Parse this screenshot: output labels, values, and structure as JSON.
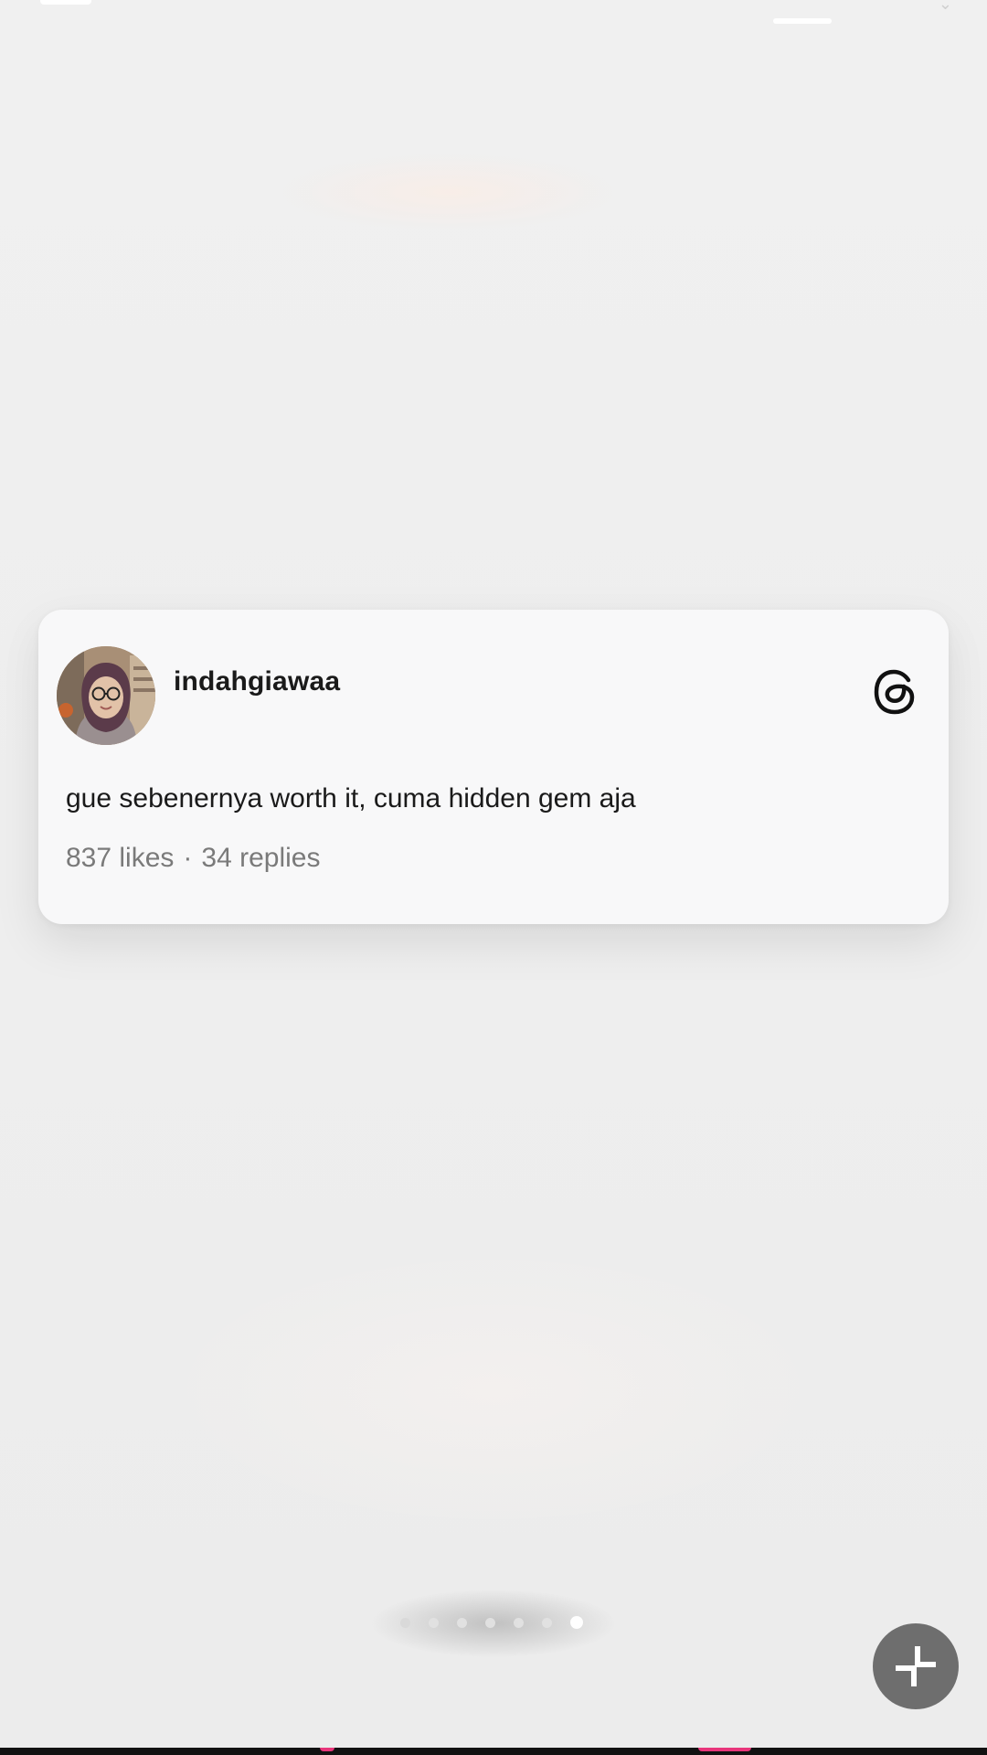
{
  "post": {
    "username": "indahgiawaa",
    "text": "gue sebenernya worth it, cuma hidden gem aja",
    "likes": "837 likes",
    "separator": "·",
    "replies": "34 replies",
    "platform_icon": "threads-icon"
  },
  "pagination": {
    "total": 7,
    "active_index": 6
  },
  "controls": {
    "collapse_icon": "collapse-icon"
  },
  "colors": {
    "background": "#eeeeee",
    "card": "#f8f8f9",
    "text_primary": "#1a1a1a",
    "text_secondary": "#7a7a7a",
    "collapse_button": "#6e6e6e",
    "accent_pink": "#e8357a"
  }
}
